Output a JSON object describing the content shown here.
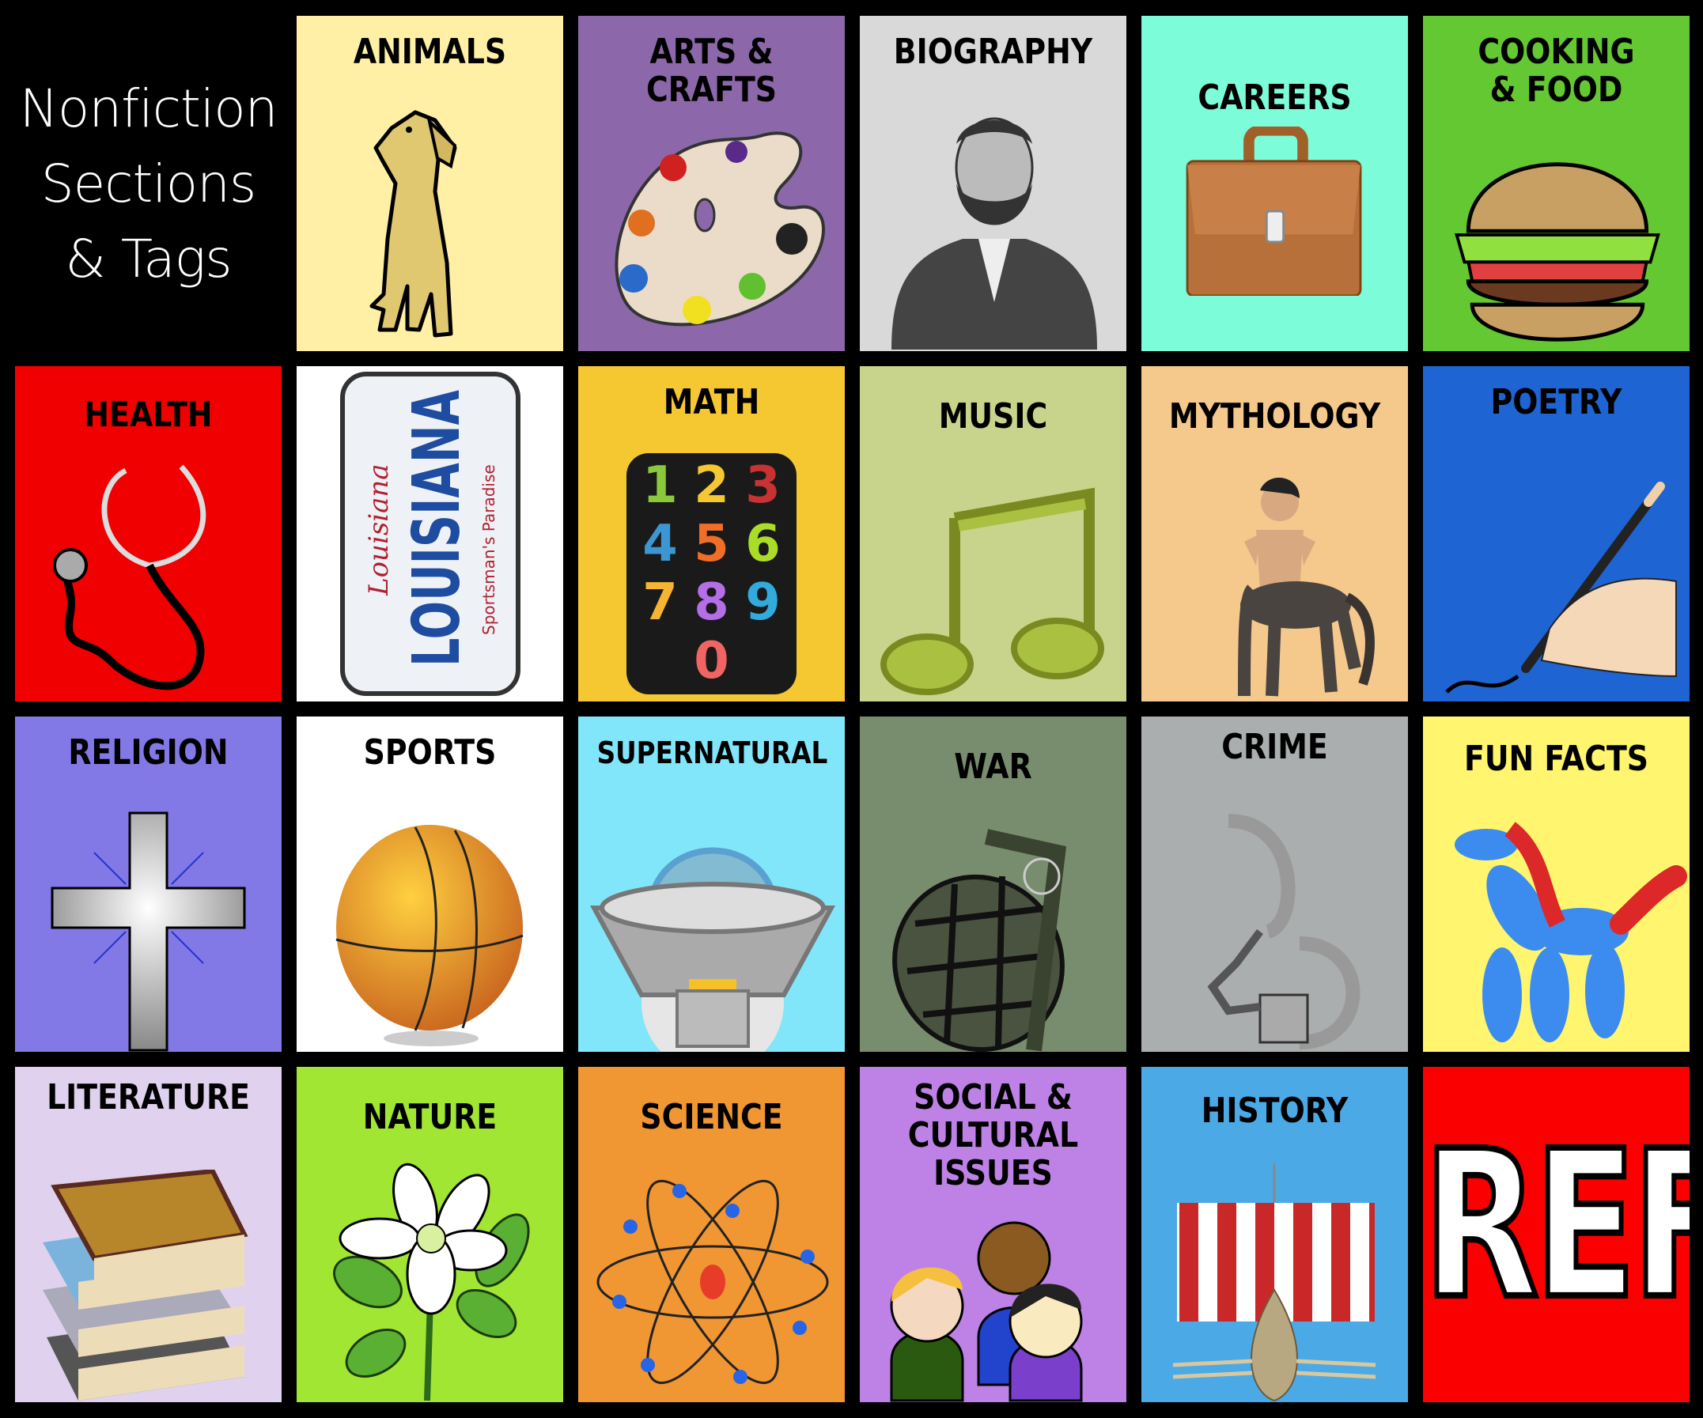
{
  "title": [
    "Nonfiction",
    "Sections",
    "& Tags"
  ],
  "tiles": [
    {
      "label": "ANIMALS",
      "color": "#fff0a6",
      "icon": "dog-icon"
    },
    {
      "label": "ARTS &\nCRAFTS",
      "color": "#8c68aa",
      "icon": "paint-palette-icon"
    },
    {
      "label": "BIOGRAPHY",
      "color": "#d9d9d9",
      "icon": "lincoln-portrait-icon"
    },
    {
      "label": "CAREERS",
      "color": "#7cfcd8",
      "icon": "briefcase-icon"
    },
    {
      "label": "COOKING\n& FOOD",
      "color": "#64c832",
      "icon": "hamburger-icon"
    },
    {
      "label": "HEALTH",
      "color": "#f00000",
      "icon": "stethoscope-icon"
    },
    {
      "label": "",
      "color": "#ffffff",
      "icon": "louisiana-license-plate-icon",
      "plate": {
        "script": "Louisiana",
        "main": "LOUISIANA",
        "tagline": "Sportsman's Paradise"
      }
    },
    {
      "label": "MATH",
      "color": "#f5c832",
      "icon": "numbers-icon",
      "digits": [
        "1",
        "2",
        "3",
        "4",
        "5",
        "6",
        "7",
        "8",
        "9",
        "0"
      ]
    },
    {
      "label": "MUSIC",
      "color": "#c8d48c",
      "icon": "music-note-icon"
    },
    {
      "label": "MYTHOLOGY",
      "color": "#f5c88c",
      "icon": "centaur-icon"
    },
    {
      "label": "POETRY",
      "color": "#1e64d2",
      "icon": "hand-writing-pen-icon"
    },
    {
      "label": "RELIGION",
      "color": "#8278e6",
      "icon": "cross-icon"
    },
    {
      "label": "SPORTS",
      "color": "#ffffff",
      "icon": "basketball-icon"
    },
    {
      "label": "SUPERNATURAL",
      "color": "#82e6fa",
      "icon": "ufo-icon"
    },
    {
      "label": "WAR",
      "color": "#788c6e",
      "icon": "grenade-icon"
    },
    {
      "label": "CRIME",
      "color": "#aaaeae",
      "icon": "handcuffs-icon"
    },
    {
      "label": "FUN FACTS",
      "color": "#fff56e",
      "icon": "balloon-animal-icon"
    },
    {
      "label": "LITERATURE",
      "color": "#e0d2ee",
      "icon": "book-stack-icon"
    },
    {
      "label": "NATURE",
      "color": "#a0e632",
      "icon": "flower-icon"
    },
    {
      "label": "SCIENCE",
      "color": "#f09632",
      "icon": "atom-icon"
    },
    {
      "label": "SOCIAL &\nCULTURAL\nISSUES",
      "color": "#be82e6",
      "icon": "people-group-icon"
    },
    {
      "label": "HISTORY",
      "color": "#4baae6",
      "icon": "viking-ship-icon"
    },
    {
      "label": "",
      "color": "#fa0000",
      "icon": "ref-text-icon",
      "ref": "REF"
    }
  ]
}
